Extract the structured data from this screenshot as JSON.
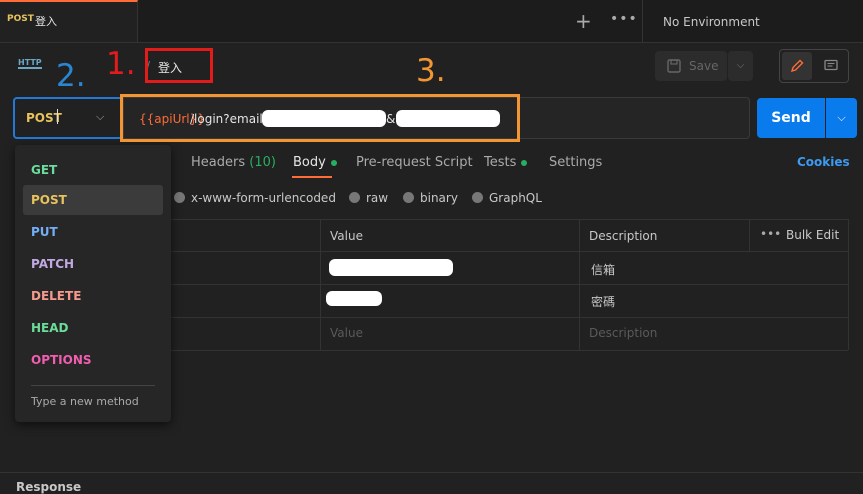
{
  "tab": {
    "method": "POST",
    "title": "登入"
  },
  "tabbar": {
    "plus": "+",
    "more": "•••"
  },
  "environment": "No Environment",
  "header": {
    "breadcrumb_title": "登入",
    "save_label": "Save"
  },
  "request": {
    "method": "POST",
    "url_variable": "{{apiUrl}}",
    "url_path": "/login?email=",
    "url_amp": "&",
    "send_label": "Send"
  },
  "subtabs": {
    "headers": "Headers",
    "headers_count": "(10)",
    "body": "Body",
    "prerequest": "Pre-request Script",
    "tests": "Tests",
    "settings": "Settings",
    "cookies": "Cookies"
  },
  "body_types": [
    "x-www-form-urlencoded",
    "raw",
    "binary",
    "GraphQL"
  ],
  "table": {
    "columns": [
      "Value",
      "Description"
    ],
    "bulk_edit": "Bulk Edit",
    "rows": [
      {
        "description": "信箱"
      },
      {
        "description": "密碼"
      }
    ],
    "placeholder": {
      "value": "Value",
      "description": "Description"
    }
  },
  "method_dropdown": {
    "items": [
      {
        "label": "GET",
        "color": "#6bdd9a"
      },
      {
        "label": "POST",
        "color": "#e8c35d"
      },
      {
        "label": "PUT",
        "color": "#74aef6"
      },
      {
        "label": "PATCH",
        "color": "#c0a8e1"
      },
      {
        "label": "DELETE",
        "color": "#f79a8e"
      },
      {
        "label": "HEAD",
        "color": "#6bdd9a"
      },
      {
        "label": "OPTIONS",
        "color": "#f15eb0"
      }
    ],
    "selected": "POST",
    "new_method_placeholder": "Type a new method"
  },
  "annotations": {
    "one": "1.",
    "two": "2.",
    "three": "3."
  },
  "response": {
    "title": "Response"
  },
  "colors": {
    "accent": "#ff6c37",
    "send": "#097bed",
    "annotation_red": "#e21b1b",
    "annotation_blue": "#2a86d3",
    "annotation_orange": "#f29532"
  }
}
